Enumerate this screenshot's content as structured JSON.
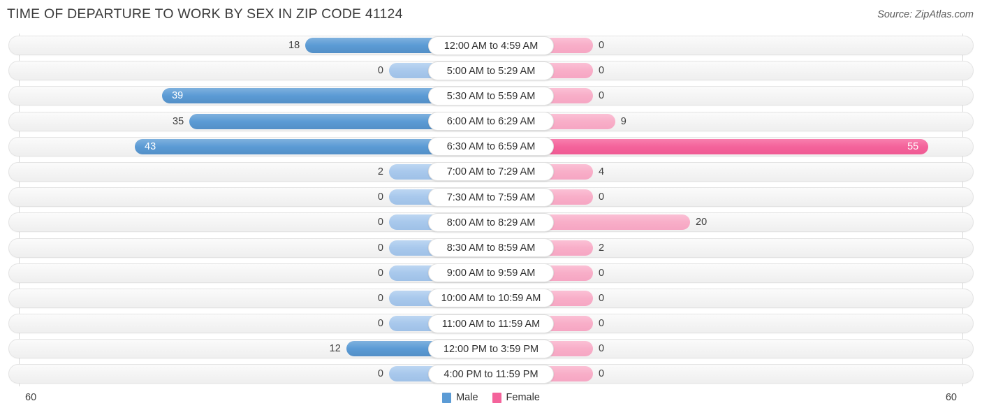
{
  "header": {
    "title": "TIME OF DEPARTURE TO WORK BY SEX IN ZIP CODE 41124",
    "source": "Source: ZipAtlas.com"
  },
  "legend": {
    "male_label": "Male",
    "female_label": "Female",
    "male_color": "#5b9bd5",
    "female_color": "#f4639b"
  },
  "axis": {
    "left_max": "60",
    "right_max": "60"
  },
  "chart_data": {
    "type": "bar",
    "title": "TIME OF DEPARTURE TO WORK BY SEX IN ZIP CODE 41124",
    "subtitle": "",
    "orientation": "horizontal-diverging",
    "xlabel": "",
    "ylabel": "",
    "xlim": [
      60,
      60
    ],
    "grid": true,
    "legend_position": "bottom-center",
    "categories": [
      "12:00 AM to 4:59 AM",
      "5:00 AM to 5:29 AM",
      "5:30 AM to 5:59 AM",
      "6:00 AM to 6:29 AM",
      "6:30 AM to 6:59 AM",
      "7:00 AM to 7:29 AM",
      "7:30 AM to 7:59 AM",
      "8:00 AM to 8:29 AM",
      "8:30 AM to 8:59 AM",
      "9:00 AM to 9:59 AM",
      "10:00 AM to 10:59 AM",
      "11:00 AM to 11:59 AM",
      "12:00 PM to 3:59 PM",
      "4:00 PM to 11:59 PM"
    ],
    "series": [
      {
        "name": "Male",
        "color": "#5b9bd5",
        "values": [
          18,
          0,
          39,
          35,
          43,
          2,
          0,
          0,
          0,
          0,
          0,
          0,
          12,
          0
        ]
      },
      {
        "name": "Female",
        "color": "#f4639b",
        "values": [
          0,
          0,
          0,
          9,
          55,
          4,
          0,
          20,
          2,
          0,
          0,
          0,
          0,
          0
        ]
      }
    ]
  },
  "rows": [
    {
      "category": "12:00 AM to 4:59 AM",
      "male": "18",
      "female": "0",
      "male_v": 18,
      "female_v": 0
    },
    {
      "category": "5:00 AM to 5:29 AM",
      "male": "0",
      "female": "0",
      "male_v": 0,
      "female_v": 0
    },
    {
      "category": "5:30 AM to 5:59 AM",
      "male": "39",
      "female": "0",
      "male_v": 39,
      "female_v": 0
    },
    {
      "category": "6:00 AM to 6:29 AM",
      "male": "35",
      "female": "9",
      "male_v": 35,
      "female_v": 9
    },
    {
      "category": "6:30 AM to 6:59 AM",
      "male": "43",
      "female": "55",
      "male_v": 43,
      "female_v": 55
    },
    {
      "category": "7:00 AM to 7:29 AM",
      "male": "2",
      "female": "4",
      "male_v": 2,
      "female_v": 4
    },
    {
      "category": "7:30 AM to 7:59 AM",
      "male": "0",
      "female": "0",
      "male_v": 0,
      "female_v": 0
    },
    {
      "category": "8:00 AM to 8:29 AM",
      "male": "0",
      "female": "20",
      "male_v": 0,
      "female_v": 20
    },
    {
      "category": "8:30 AM to 8:59 AM",
      "male": "0",
      "female": "2",
      "male_v": 0,
      "female_v": 2
    },
    {
      "category": "9:00 AM to 9:59 AM",
      "male": "0",
      "female": "0",
      "male_v": 0,
      "female_v": 0
    },
    {
      "category": "10:00 AM to 10:59 AM",
      "male": "0",
      "female": "0",
      "male_v": 0,
      "female_v": 0
    },
    {
      "category": "11:00 AM to 11:59 AM",
      "male": "0",
      "female": "0",
      "male_v": 0,
      "female_v": 0
    },
    {
      "category": "12:00 PM to 3:59 PM",
      "male": "12",
      "female": "0",
      "male_v": 12,
      "female_v": 0
    },
    {
      "category": "4:00 PM to 11:59 PM",
      "male": "0",
      "female": "0",
      "male_v": 0,
      "female_v": 0
    }
  ]
}
